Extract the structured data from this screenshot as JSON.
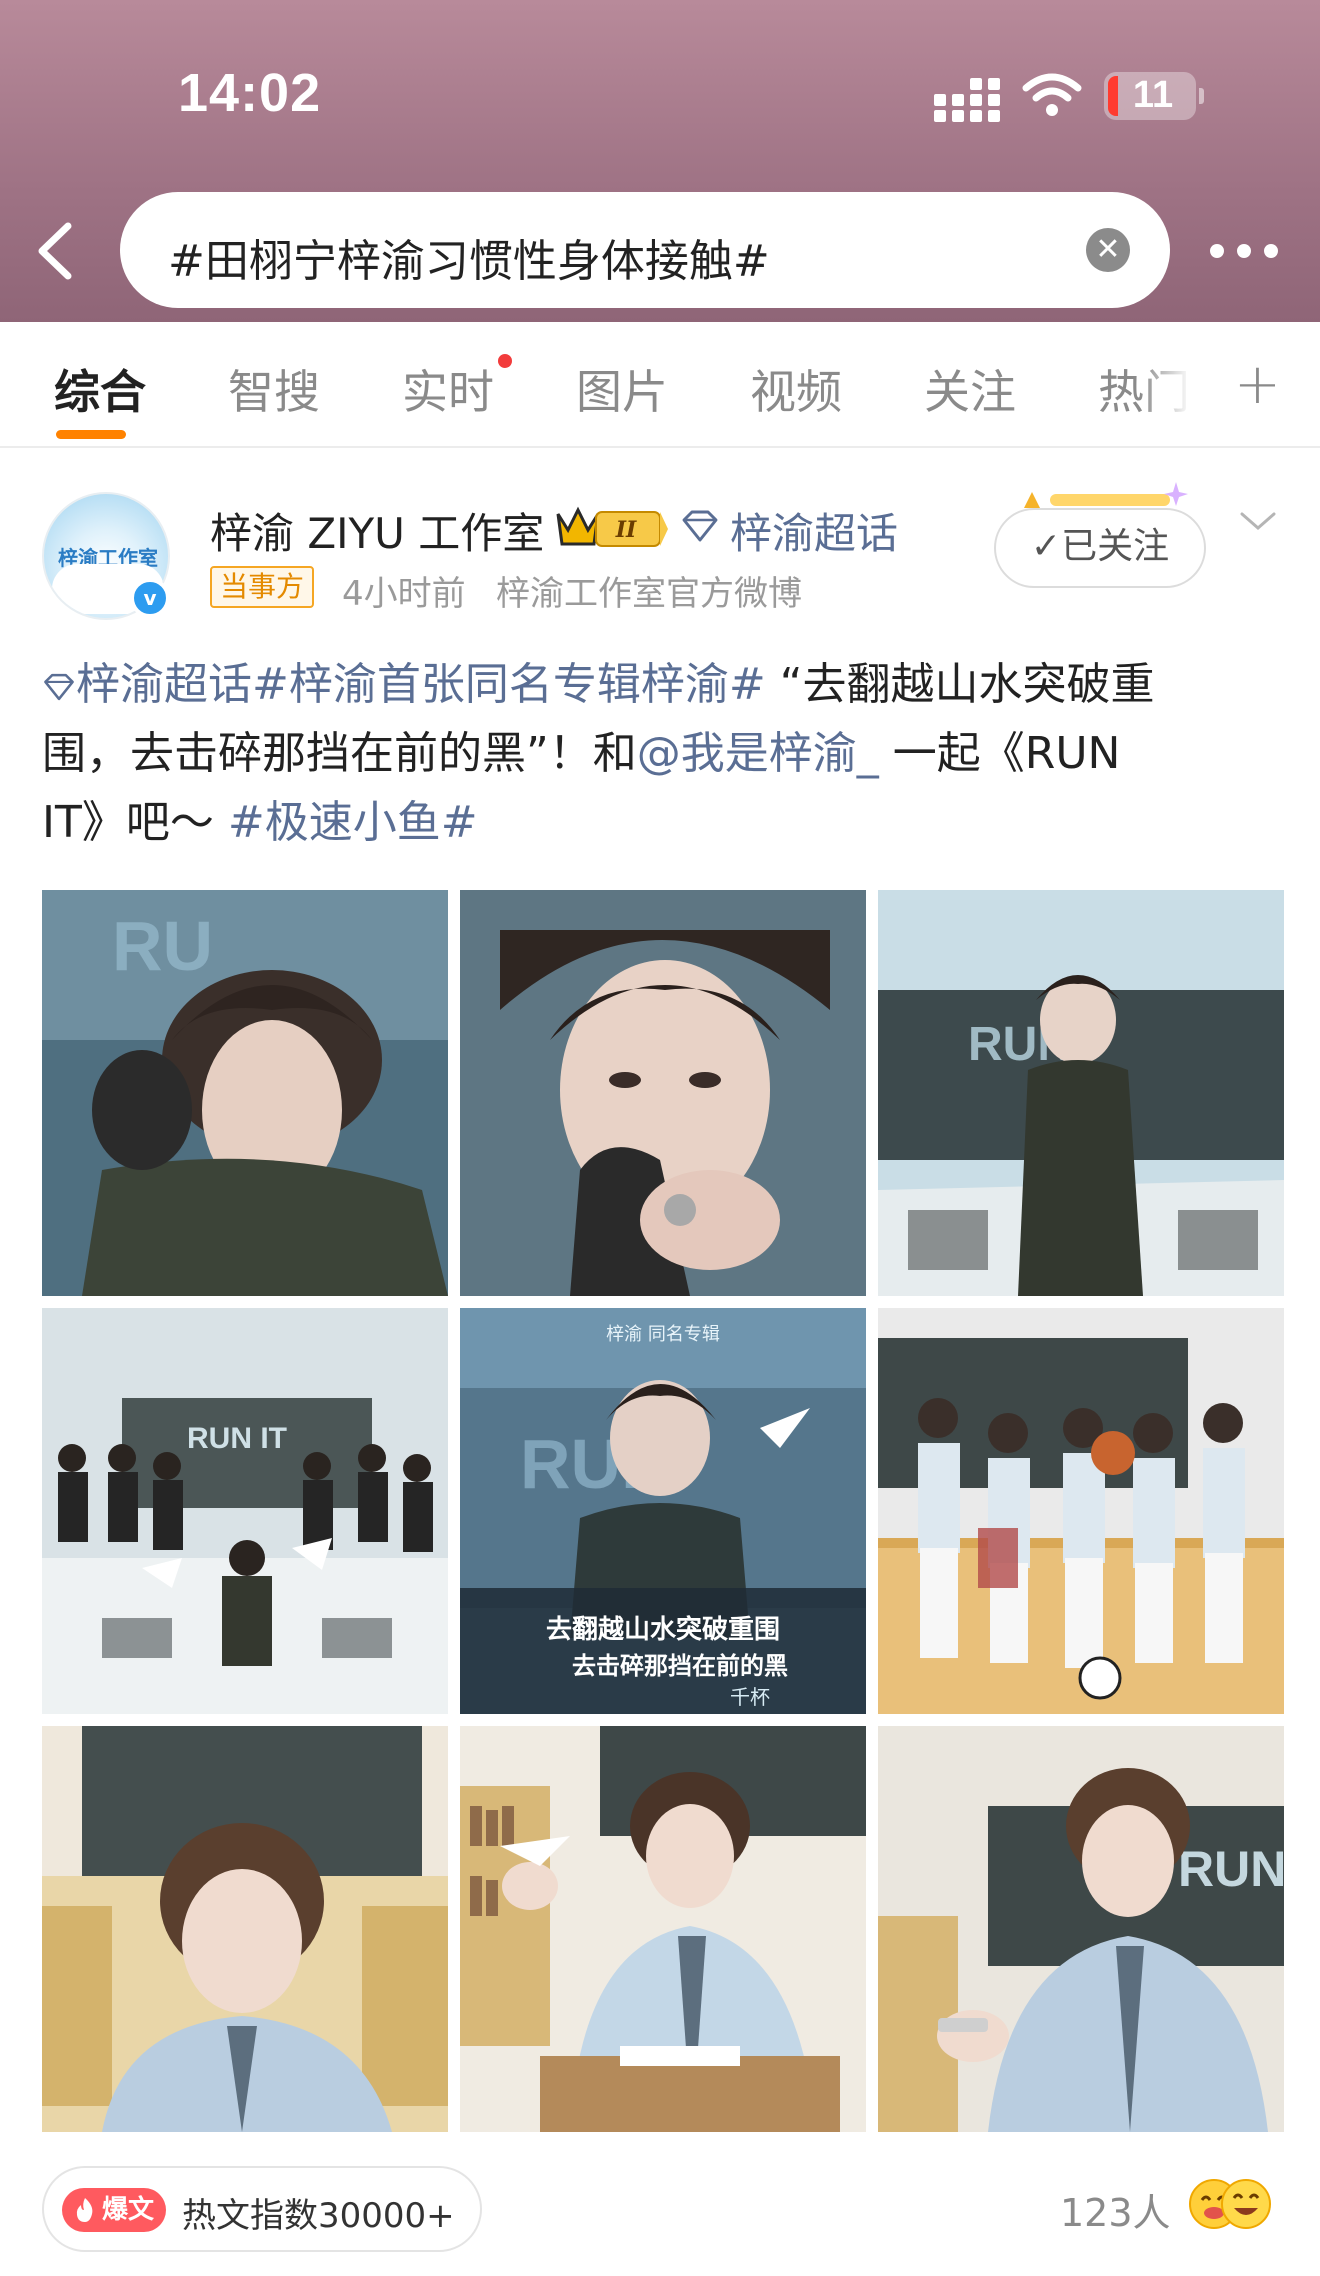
{
  "status_bar": {
    "time": "14:02",
    "battery": "11",
    "icons": [
      "cellular-signal-icon",
      "wifi-icon",
      "battery-icon"
    ]
  },
  "search": {
    "query": "#田栩宁梓渝习惯性身体接触#",
    "icons": [
      "back-arrow-icon",
      "clear-icon",
      "more-icon"
    ]
  },
  "tabs": [
    {
      "label": "综合",
      "active": true
    },
    {
      "label": "智搜"
    },
    {
      "label": "实时",
      "has_dot": true
    },
    {
      "label": "图片"
    },
    {
      "label": "视频"
    },
    {
      "label": "关注"
    },
    {
      "label": "热门"
    },
    {
      "label": "+"
    }
  ],
  "post": {
    "author": "梓渝 ZIYU 工作室",
    "avatar_text": "梓渝工作室",
    "crown_level": "II",
    "topic": "梓渝超话",
    "badge": "当事方",
    "time": "4小时前",
    "source": "梓渝工作室官方微博",
    "follow_label": "已关注",
    "text": {
      "line1_tag1": "梓渝超话",
      "line1_tag2": "#梓渝首张同名专辑梓渝#",
      "line1_rest": " “去翻越山水突破重",
      "line2_start": "围，去击碎那挡在前的黑”！和",
      "line2_mention": "@我是梓渝_",
      "line2_rest": " 一起《RUN",
      "line3_start": "IT》吧～ ",
      "line3_tag": "#极速小鱼#"
    },
    "images": [
      {
        "desc": "portrait-hand-on-head"
      },
      {
        "desc": "closeup-gloved-hand"
      },
      {
        "desc": "standing-by-chalkboard",
        "text": "RUN"
      },
      {
        "desc": "group-in-classroom",
        "text": "RUN IT"
      },
      {
        "desc": "album-poster",
        "header": "梓渝 同名专辑",
        "line1": "去翻越山水突破重围",
        "line2": "去击碎那挡在前的黑",
        "sign": "千杯"
      },
      {
        "desc": "group-by-lockers"
      },
      {
        "desc": "school-uniform-portrait"
      },
      {
        "desc": "paper-plane-desk"
      },
      {
        "desc": "uniform-holding-phone",
        "text": "RUN"
      }
    ],
    "hot_badge": "爆文",
    "hot_text": "热文指数30000+",
    "people_count": "123人"
  },
  "colors": {
    "header_bg": "#a57889",
    "accent": "#ff8200",
    "link": "#5a6e94",
    "hot": "#ff5a5f"
  }
}
